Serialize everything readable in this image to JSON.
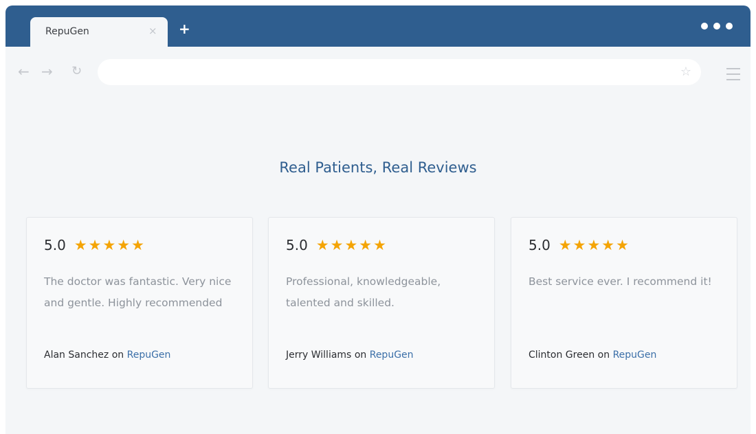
{
  "browser": {
    "tab_title": "RepuGen",
    "tab_close": "×",
    "new_tab": "+",
    "back": "←",
    "forward": "→",
    "reload": "↻",
    "bookmark": "☆",
    "address_value": ""
  },
  "page": {
    "heading": "Real Patients, Real Reviews"
  },
  "reviews": [
    {
      "rating": "5.0",
      "stars": "★★★★★",
      "text": "The doctor was fantastic. Very nice and gentle. Highly recommended",
      "author": "Alan Sanchez",
      "connector": "on",
      "source": "RepuGen"
    },
    {
      "rating": "5.0",
      "stars": "★★★★★",
      "text": "Professional, knowledgeable, talented and skilled.",
      "author": "Jerry Williams",
      "connector": "on",
      "source": "RepuGen"
    },
    {
      "rating": "5.0",
      "stars": "★★★★★",
      "text": "Best service ever. I recommend it!",
      "author": "Clinton Green",
      "connector": "on",
      "source": "RepuGen"
    }
  ],
  "colors": {
    "brand_blue": "#2f5e8f",
    "star": "#f4a405",
    "link": "#3b6fa8"
  }
}
